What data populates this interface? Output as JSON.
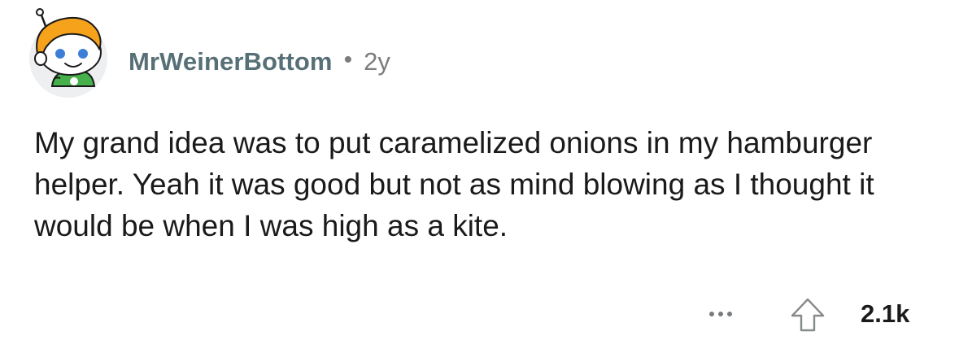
{
  "comment": {
    "author": "MrWeinerBottom",
    "separator": "•",
    "age": "2y",
    "body": "My grand idea was to put caramelized onions in my hamburger helper. Yeah it was good but not as mind blowing as I thought it would be when I was high as a kite.",
    "score": "2.1k"
  },
  "icons": {
    "avatar": "snoo-avatar-icon",
    "more": "more-options-icon",
    "upvote": "upvote-arrow-icon"
  },
  "colors": {
    "username": "#576f76",
    "meta": "#7c7c7c",
    "body_text": "#1a1a1b",
    "avatar_bg": "#edeff1",
    "avatar_hair": "#f7a21b",
    "avatar_shirt": "#46b04a"
  }
}
